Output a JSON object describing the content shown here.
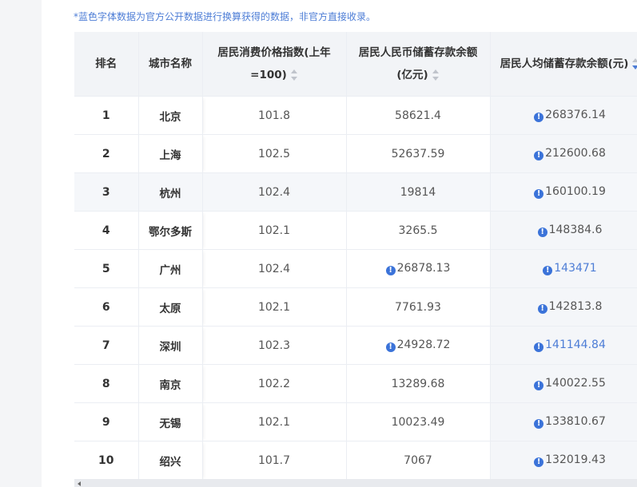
{
  "note": "*蓝色字体数据为官方公开数据进行换算获得的数据，非官方直接收录。",
  "columns": {
    "rank": "排名",
    "city": "城市名称",
    "cpi": "居民消费价格指数(上年=100)",
    "deposit": "居民人民币储蓄存款余额(亿元)",
    "per_capita": "居民人均储蓄存款余额(元)"
  },
  "rows": [
    {
      "rank": "1",
      "city": "北京",
      "cpi": "101.8",
      "deposit": "58621.4",
      "deposit_derived": false,
      "per_capita": "268376.14",
      "per_capita_blue": false
    },
    {
      "rank": "2",
      "city": "上海",
      "cpi": "102.5",
      "deposit": "52637.59",
      "deposit_derived": false,
      "per_capita": "212600.68",
      "per_capita_blue": false
    },
    {
      "rank": "3",
      "city": "杭州",
      "cpi": "102.4",
      "deposit": "19814",
      "deposit_derived": false,
      "per_capita": "160100.19",
      "per_capita_blue": false
    },
    {
      "rank": "4",
      "city": "鄂尔多斯",
      "cpi": "102.1",
      "deposit": "3265.5",
      "deposit_derived": false,
      "per_capita": "148384.6",
      "per_capita_blue": false
    },
    {
      "rank": "5",
      "city": "广州",
      "cpi": "102.4",
      "deposit": "26878.13",
      "deposit_derived": true,
      "per_capita": "143471",
      "per_capita_blue": true
    },
    {
      "rank": "6",
      "city": "太原",
      "cpi": "102.1",
      "deposit": "7761.93",
      "deposit_derived": false,
      "per_capita": "142813.8",
      "per_capita_blue": false
    },
    {
      "rank": "7",
      "city": "深圳",
      "cpi": "102.3",
      "deposit": "24928.72",
      "deposit_derived": true,
      "per_capita": "141144.84",
      "per_capita_blue": true
    },
    {
      "rank": "8",
      "city": "南京",
      "cpi": "102.2",
      "deposit": "13289.68",
      "deposit_derived": false,
      "per_capita": "140022.55",
      "per_capita_blue": false
    },
    {
      "rank": "9",
      "city": "无锡",
      "cpi": "102.1",
      "deposit": "10023.49",
      "deposit_derived": false,
      "per_capita": "133810.67",
      "per_capita_blue": false
    },
    {
      "rank": "10",
      "city": "绍兴",
      "cpi": "101.7",
      "deposit": "7067",
      "deposit_derived": false,
      "per_capita": "132019.43",
      "per_capita_blue": false
    }
  ],
  "icons": {
    "warn": "info-icon",
    "sort": "sort-caret-icon"
  },
  "colors": {
    "accent": "#4d7dd6",
    "icon": "#3b73d9",
    "header_bg": "#f2f4f7"
  }
}
